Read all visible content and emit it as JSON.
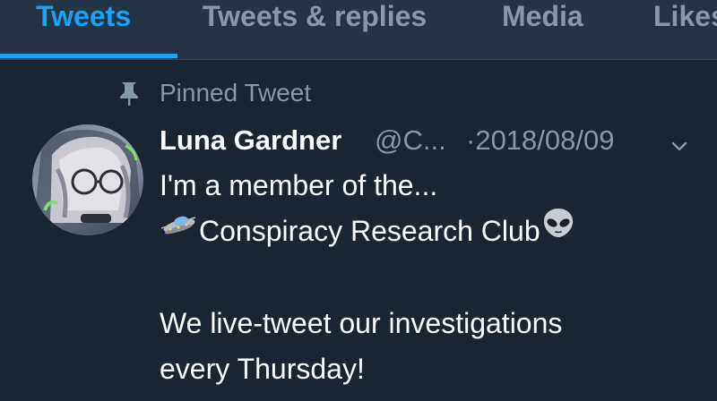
{
  "tabs": [
    {
      "label": "Tweets",
      "active": true
    },
    {
      "label": "Tweets & replies",
      "active": false
    },
    {
      "label": "Media",
      "active": false
    },
    {
      "label": "Likes",
      "active": false
    }
  ],
  "pinned": {
    "label": "Pinned Tweet",
    "icon": "pin-icon"
  },
  "tweet": {
    "author_name": "Luna Gardner",
    "handle": "@C...",
    "date": "·2018/08/09",
    "caret_icon": "chevron-down-icon",
    "avatar_icon": "avatar",
    "text_line_1": "I'm a member of the...",
    "text_line_2": "Conspiracy Research Club",
    "emoji_before": "flying-saucer-icon",
    "emoji_after": "alien-icon",
    "text_line_3": "We live-tweet our investigations",
    "text_line_4": "every Thursday!"
  },
  "colors": {
    "background": "#1b2431",
    "tabbar": "#243447",
    "accent": "#1da1f2",
    "secondary_text": "#8899a6",
    "primary_text": "#ffffff"
  }
}
